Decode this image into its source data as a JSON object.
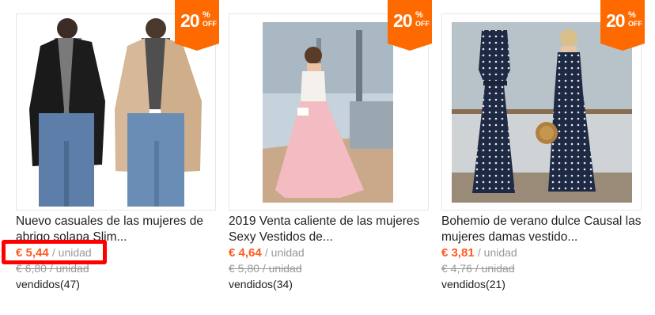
{
  "products": [
    {
      "badge": {
        "percent": "20",
        "sign": "%",
        "off": "OFF"
      },
      "title": "Nuevo casuales de las mujeres de abrigo solapa Slim...",
      "price": "€ 5,44",
      "unit": "/ unidad",
      "old_price": "€ 6,80 / unidad",
      "sold": "vendidos(47)",
      "image": "women-blazers-photo"
    },
    {
      "badge": {
        "percent": "20",
        "sign": "%",
        "off": "OFF"
      },
      "title": "2019 Venta caliente de las mujeres Sexy Vestidos de...",
      "price": "€ 4,64",
      "unit": "/ unidad",
      "old_price": "€ 5,80 / unidad",
      "sold": "vendidos(34)",
      "image": "pink-maxi-dress-photo"
    },
    {
      "badge": {
        "percent": "20",
        "sign": "%",
        "off": "OFF"
      },
      "title": "Bohemio de verano dulce Causal las mujeres damas vestido...",
      "price": "€ 3,81",
      "unit": "/ unidad",
      "old_price": "€ 4,76 / unidad",
      "sold": "vendidos(21)",
      "image": "polka-dot-dresses-photo"
    }
  ],
  "colors": {
    "accent": "#ff6a00",
    "price": "#ff5a1f",
    "highlight": "#ff0000"
  }
}
